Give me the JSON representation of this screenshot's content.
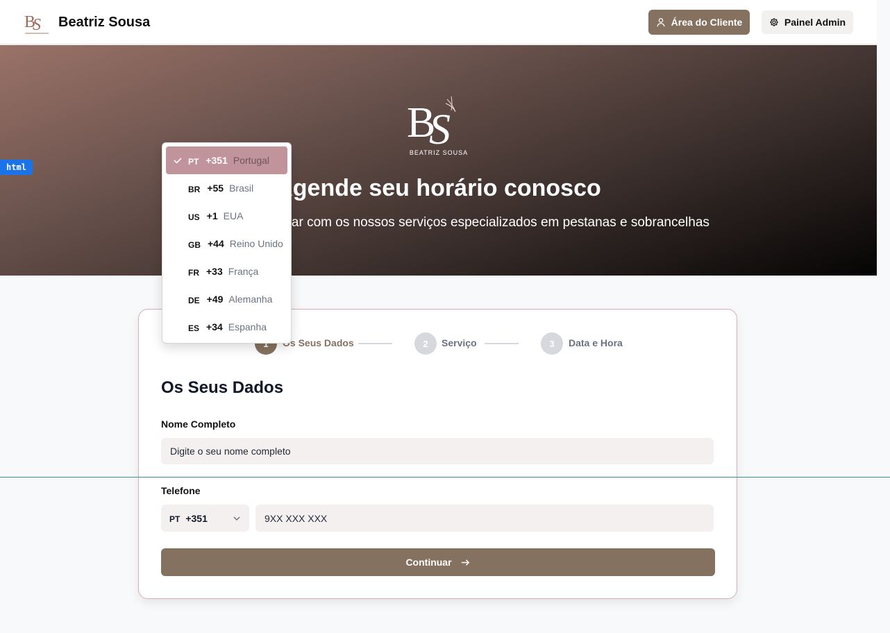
{
  "header": {
    "brand_name": "Beatriz Sousa",
    "client_area_label": "Área do Cliente",
    "admin_panel_label": "Painel Admin"
  },
  "hero": {
    "logo_text": "BEATRIZ SOUSA",
    "title": "Agende seu horário conosco",
    "subtitle": "Transforme o seu olhar com os nossos serviços especializados em pestanas e sobrancelhas"
  },
  "devtools_badge": "html",
  "stepper": {
    "steps": [
      {
        "number": "1",
        "label": "Os Seus Dados",
        "active": true
      },
      {
        "number": "2",
        "label": "Serviço",
        "active": false
      },
      {
        "number": "3",
        "label": "Data e Hora",
        "active": false
      }
    ]
  },
  "form": {
    "section_title": "Os Seus Dados",
    "name_label": "Nome Completo",
    "name_placeholder": "Digite o seu nome completo",
    "phone_label": "Telefone",
    "selected_country_code": "PT",
    "selected_dial": "+351",
    "phone_placeholder": "9XX XXX XXX",
    "continue_label": "Continuar"
  },
  "country_dropdown": {
    "options": [
      {
        "code": "PT",
        "dial": "+351",
        "name": "Portugal",
        "selected": true
      },
      {
        "code": "BR",
        "dial": "+55",
        "name": "Brasil",
        "selected": false
      },
      {
        "code": "US",
        "dial": "+1",
        "name": "EUA",
        "selected": false
      },
      {
        "code": "GB",
        "dial": "+44",
        "name": "Reino Unido",
        "selected": false
      },
      {
        "code": "FR",
        "dial": "+33",
        "name": "França",
        "selected": false
      },
      {
        "code": "DE",
        "dial": "+49",
        "name": "Alemanha",
        "selected": false
      },
      {
        "code": "ES",
        "dial": "+34",
        "name": "Espanha",
        "selected": false
      }
    ]
  },
  "icons": {
    "client_area": "user-icon",
    "admin_panel": "gear-icon",
    "select_chevron": "chevron-down-icon",
    "continue": "arrow-right-icon",
    "selected_option": "check-icon"
  },
  "colors": {
    "accent": "#85715f",
    "selected_option": "#c0949a",
    "card_border": "#d7aeb4",
    "input_bg": "#f5f0f0"
  }
}
